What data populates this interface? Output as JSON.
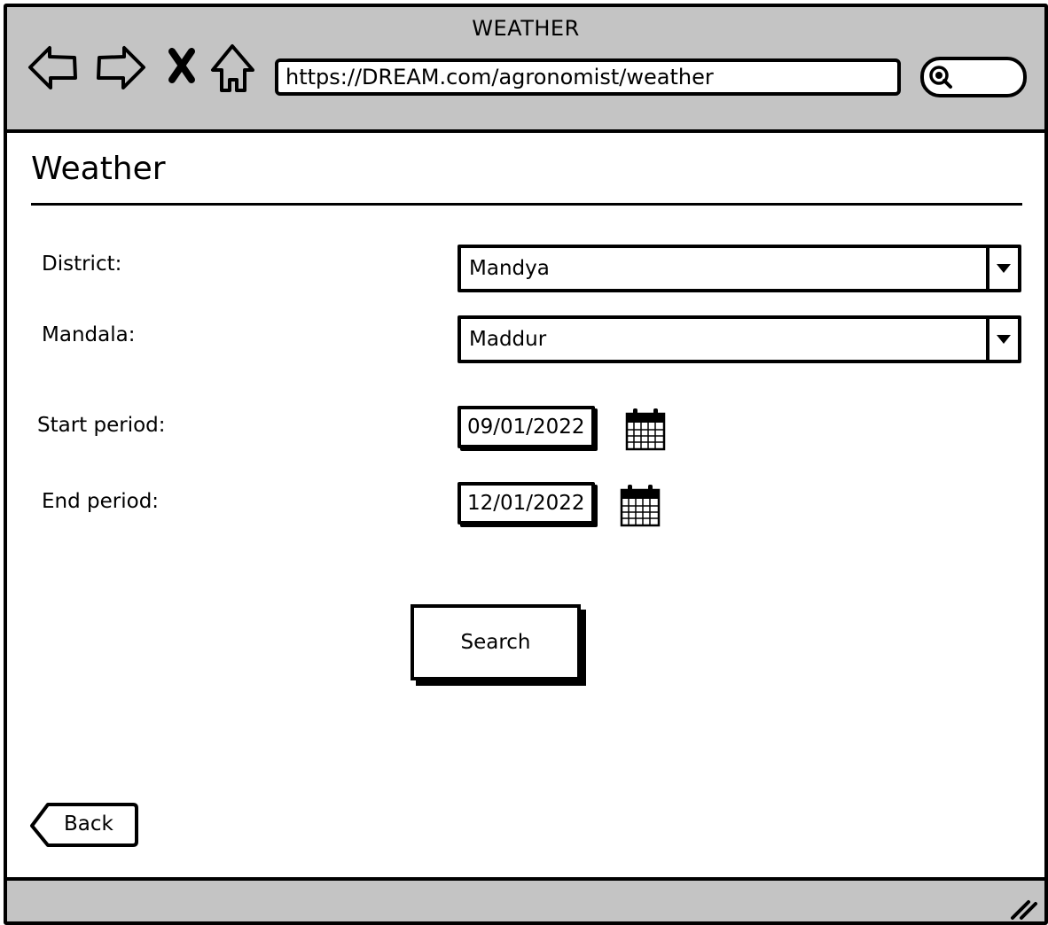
{
  "window": {
    "title": "WEATHER",
    "url": "https://DREAM.com/agronomist/weather"
  },
  "icons": {
    "back": "back-arrow-icon",
    "forward": "forward-arrow-icon",
    "close": "close-x-icon",
    "home": "home-icon",
    "search": "search-icon",
    "calendar": "calendar-icon",
    "dropdown": "dropdown-caret-icon",
    "resize": "resize-grip-icon"
  },
  "page": {
    "title": "Weather"
  },
  "form": {
    "district": {
      "label": "District:",
      "value": "Mandya"
    },
    "mandala": {
      "label": "Mandala:",
      "value": "Maddur"
    },
    "start_period": {
      "label": "Start period:",
      "value": "09/01/2022"
    },
    "end_period": {
      "label": "End period:",
      "value": "12/01/2022"
    },
    "search_label": "Search"
  },
  "footer": {
    "back_label": "Back"
  },
  "colors": {
    "chrome": "#c4c4c4",
    "ink": "#000000",
    "background": "#ffffff"
  }
}
